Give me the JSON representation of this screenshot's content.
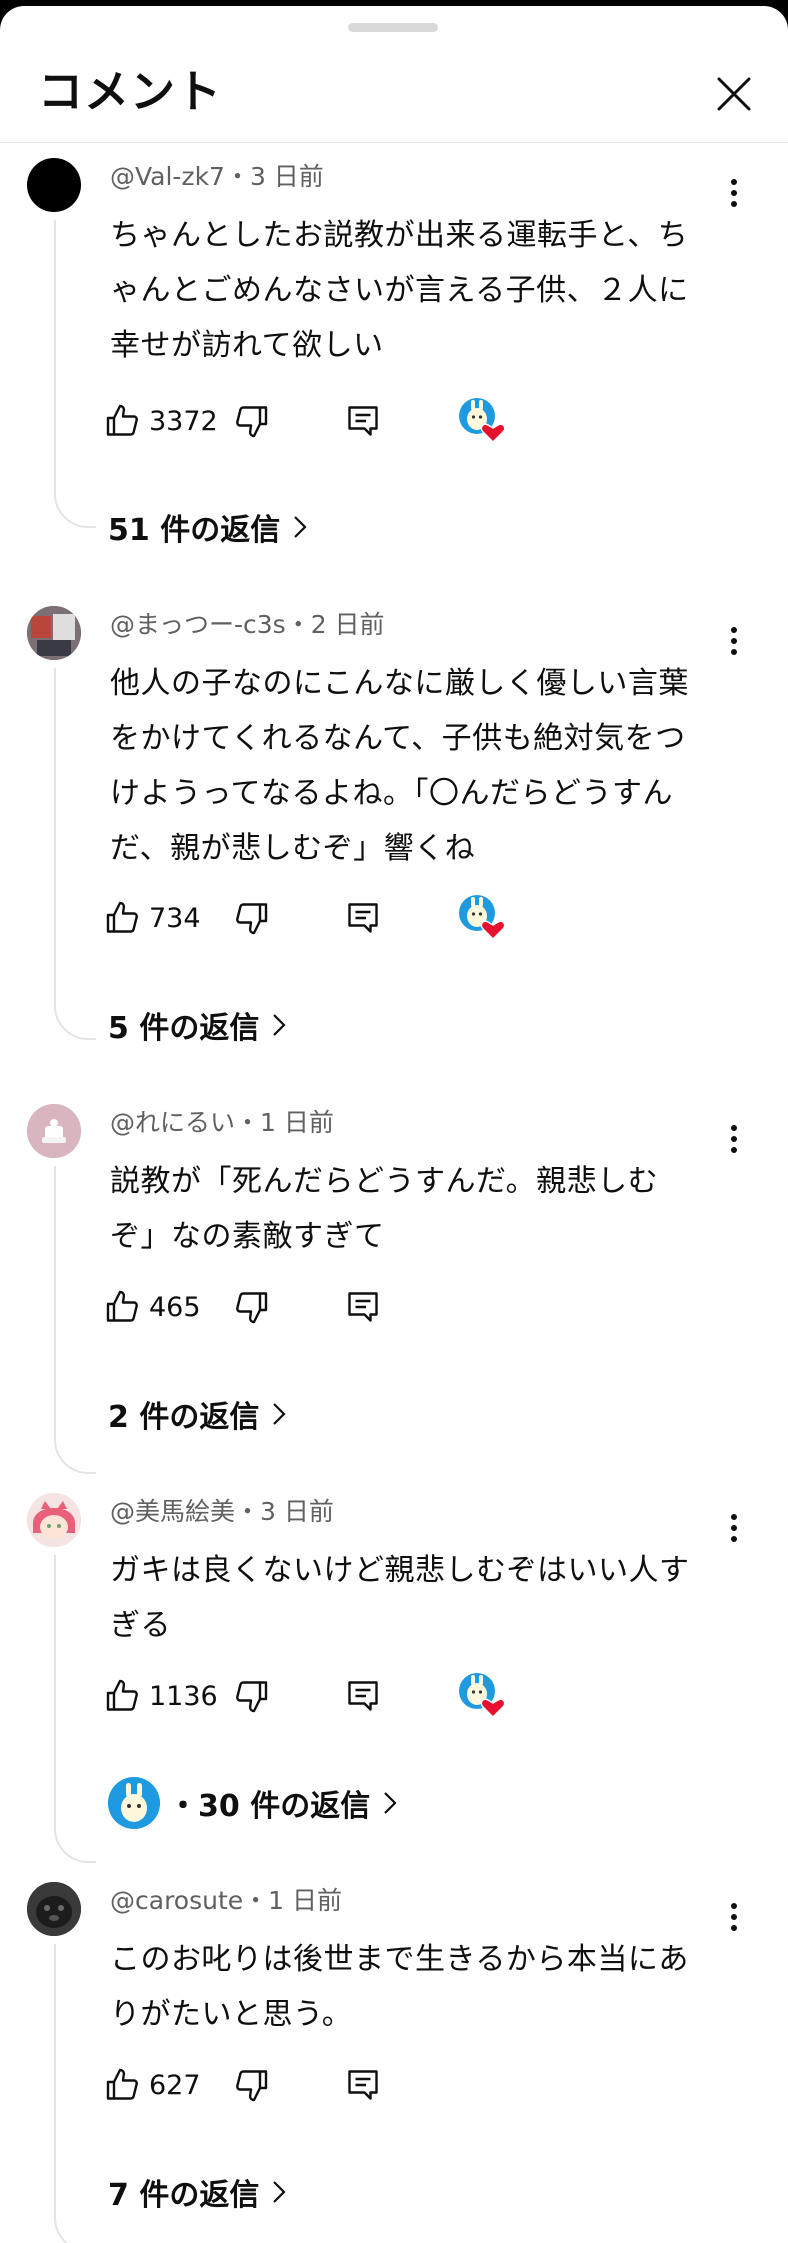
{
  "header": {
    "title": "コメント"
  },
  "comments": [
    {
      "meta": "@Val-zk7・3 日前",
      "text": "ちゃんとしたお説教が出来る運転手と、ち\nゃんとごめんなさいが言える子供、２人に\n幸せが訪れて欲しい",
      "likes": "3372",
      "replies": "51 件の返信",
      "hearted": true
    },
    {
      "meta": "@まっつー-c3s・2 日前",
      "text": "他人の子なのにこんなに厳しく優しい言葉\nをかけてくれるなんて、子供も絶対気をつ\nけようってなるよね。「〇んだらどうすん\nだ、親が悲しむぞ」響くね",
      "likes": "734",
      "replies": "5 件の返信",
      "hearted": true
    },
    {
      "meta": "@れにるい・1 日前",
      "text": "説教が「死んだらどうすんだ。親悲しむ\nぞ」なの素敵すぎて",
      "likes": "465",
      "replies": "2 件の返信",
      "hearted": false
    },
    {
      "meta": "@美馬絵美・3 日前",
      "text": "ガキは良くないけど親悲しむぞはいい人す\nぎる",
      "likes": "1136",
      "replies": "・30 件の返信",
      "hearted": true
    },
    {
      "meta": "@carosute・1 日前",
      "text": "このお叱りは後世まで生きるから本当にあ\nりがたいと思う。",
      "likes": "627",
      "replies": "7 件の返信",
      "hearted": false
    }
  ],
  "colors": {
    "text": "#0f0f0f",
    "meta": "#606060",
    "heart": "#e8112d",
    "creator_blue": "#1e9be0"
  },
  "icons": [
    "close-icon",
    "more-icon",
    "like-icon",
    "dislike-icon",
    "reply-icon",
    "creator-heart-icon",
    "chevron-right-icon"
  ]
}
